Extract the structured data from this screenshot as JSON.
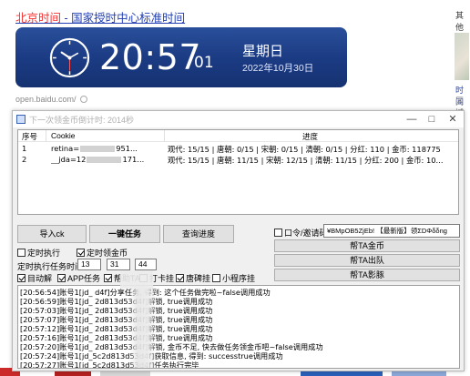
{
  "result": {
    "title_city": "北京时间",
    "title_rest": " - 国家授时中心标准时间",
    "time": "20:57",
    "seconds": "01",
    "weekday": "星期日",
    "date": "2022年10月30日",
    "source": "open.baidu.com/"
  },
  "right_col": {
    "t1": "其他",
    "t2": "时间",
    "t3": "区域"
  },
  "window": {
    "title": "下一次领金币倒计时: 2014秒",
    "controls": {
      "minimize": "—",
      "maximize": "□",
      "close": "✕"
    }
  },
  "table": {
    "headers": [
      "序号",
      "Cookie",
      "进度"
    ],
    "rows": [
      {
        "index": "1",
        "cookie_prefix": "retina=",
        "cookie_suffix": "951...",
        "progress": "观代: 15/15 | 唐朝: 0/15 | 宋朝: 0/15 | 清朝: 0/15 | 分红: 110 | 金币: 118775"
      },
      {
        "index": "2",
        "cookie_prefix": "__jda=12",
        "cookie_suffix": "171...",
        "progress": "观代: 15/15 | 唐朝: 11/15 | 宋朝: 12/15 | 清朝: 11/15 | 分红: 200 | 金币: 10..."
      }
    ]
  },
  "buttons": {
    "import_ck": "导入ck",
    "one_click": "一键任务",
    "query": "查询进度",
    "help_coin": "帮TA金币",
    "help_team": "帮TA出队",
    "help_shadow": "帮TA影豚"
  },
  "options": {
    "timed_run": "定时执行",
    "timed_coin": "定时领金币",
    "schedule_label": "定时执行任务时间",
    "hour": "13",
    "minute": "31",
    "second": "44",
    "token_check": "口令/邀请码/ck",
    "token_value": "¥BMpOB5ZjEb! 【最新版】领ΣDΦδδng",
    "tasks": [
      "目动解",
      "APP任务",
      "帮助TA",
      "打卡挂",
      "唐碑挂",
      "小程序挂"
    ]
  },
  "log": [
    "[20:56:54]账号1[jd_          d4f]分享任务, 得到: 这个任务做完啦~false调用成功",
    "[20:56:59]账号1[jd_    2d813d53d4f]解锁, true调用成功",
    "[20:57:03]账号1[jd_    2d813d53d4f]解锁, true调用成功",
    "[20:57:07]账号1[jd_    2d813d53d4f]解锁, true调用成功",
    "[20:57:12]账号1[jd_    2d813d53d4f]解锁, true调用成功",
    "[20:57:16]账号1[jd_    2d813d53d4f]解锁, true调用成功",
    "[20:57:20]账号1[jd_    2d813d53d4f]解锁, 金币不足, 快去做任务领金币吧~false调用成功",
    "[20:57:24]账号1[jd_5c2d813d53d4f]获取信息, 得到: successtrue调用成功",
    "[20:57:27]账号1[jd_5c2d813d53d4f]任务执行完毕"
  ],
  "colors": {
    "accent_link": "#2440b3",
    "highlight_red": "#f73131",
    "clock_bg": "#1a3a82"
  }
}
